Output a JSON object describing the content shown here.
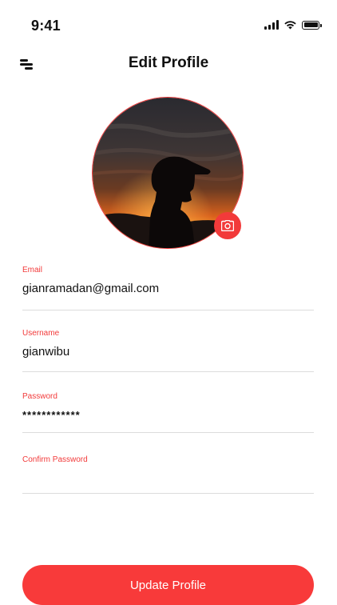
{
  "status_bar": {
    "time": "9:41",
    "icons": [
      "cellular-signal-icon",
      "wifi-icon",
      "battery-icon"
    ]
  },
  "header": {
    "title": "Edit Profile",
    "menu_icon": "menu-icon"
  },
  "avatar": {
    "camera_icon": "camera-icon"
  },
  "form": {
    "email": {
      "label": "Email",
      "value": "gianramadan@gmail.com"
    },
    "username": {
      "label": "Username",
      "value": "gianwibu"
    },
    "password": {
      "label": "Password",
      "value": "************"
    },
    "confirm_password": {
      "label": "Confirm Password",
      "value": ""
    }
  },
  "update_button": {
    "label": "Update Profile"
  },
  "colors": {
    "accent": "#f83a3a",
    "divider": "#dcdcdc",
    "text": "#111111"
  }
}
